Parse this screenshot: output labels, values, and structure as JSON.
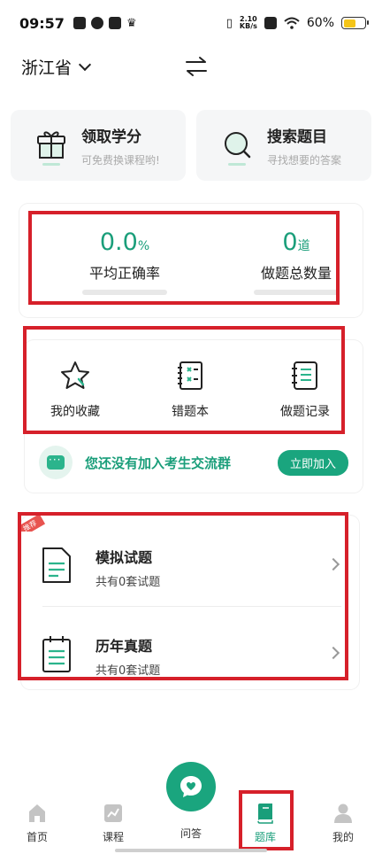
{
  "status_bar": {
    "time": "09:57",
    "net_speed_value": "2.10",
    "net_speed_unit": "KB/s",
    "battery": "60%"
  },
  "header": {
    "province": "浙江省"
  },
  "quick_cards": [
    {
      "title": "领取学分",
      "subtitle": "可免费换课程哟!",
      "icon": "gift-icon"
    },
    {
      "title": "搜索题目",
      "subtitle": "寻找想要的答案",
      "icon": "search-icon"
    }
  ],
  "stats": {
    "accuracy_value": "0.0",
    "accuracy_unit": "%",
    "accuracy_label": "平均正确率",
    "count_value": "0",
    "count_unit": "道",
    "count_label": "做题总数量"
  },
  "tools": [
    {
      "label": "我的收藏",
      "icon": "star-icon"
    },
    {
      "label": "错题本",
      "icon": "wrong-book-icon"
    },
    {
      "label": "做题记录",
      "icon": "record-icon"
    }
  ],
  "group_banner": {
    "text": "您还没有加入考生交流群",
    "button": "立即加入"
  },
  "badge": "推荐",
  "exams": [
    {
      "title": "模拟试题",
      "subtitle": "共有0套试题",
      "icon": "document-icon"
    },
    {
      "title": "历年真题",
      "subtitle": "共有0套试题",
      "icon": "clipboard-icon"
    }
  ],
  "tabs": [
    {
      "label": "首页",
      "icon": "home-icon"
    },
    {
      "label": "课程",
      "icon": "chart-icon"
    },
    {
      "label": "问答",
      "icon": "heart-chat-icon"
    },
    {
      "label": "题库",
      "icon": "book-icon"
    },
    {
      "label": "我的",
      "icon": "person-icon"
    }
  ],
  "colors": {
    "accent": "#1a9e7a",
    "highlight": "#d6202a"
  }
}
